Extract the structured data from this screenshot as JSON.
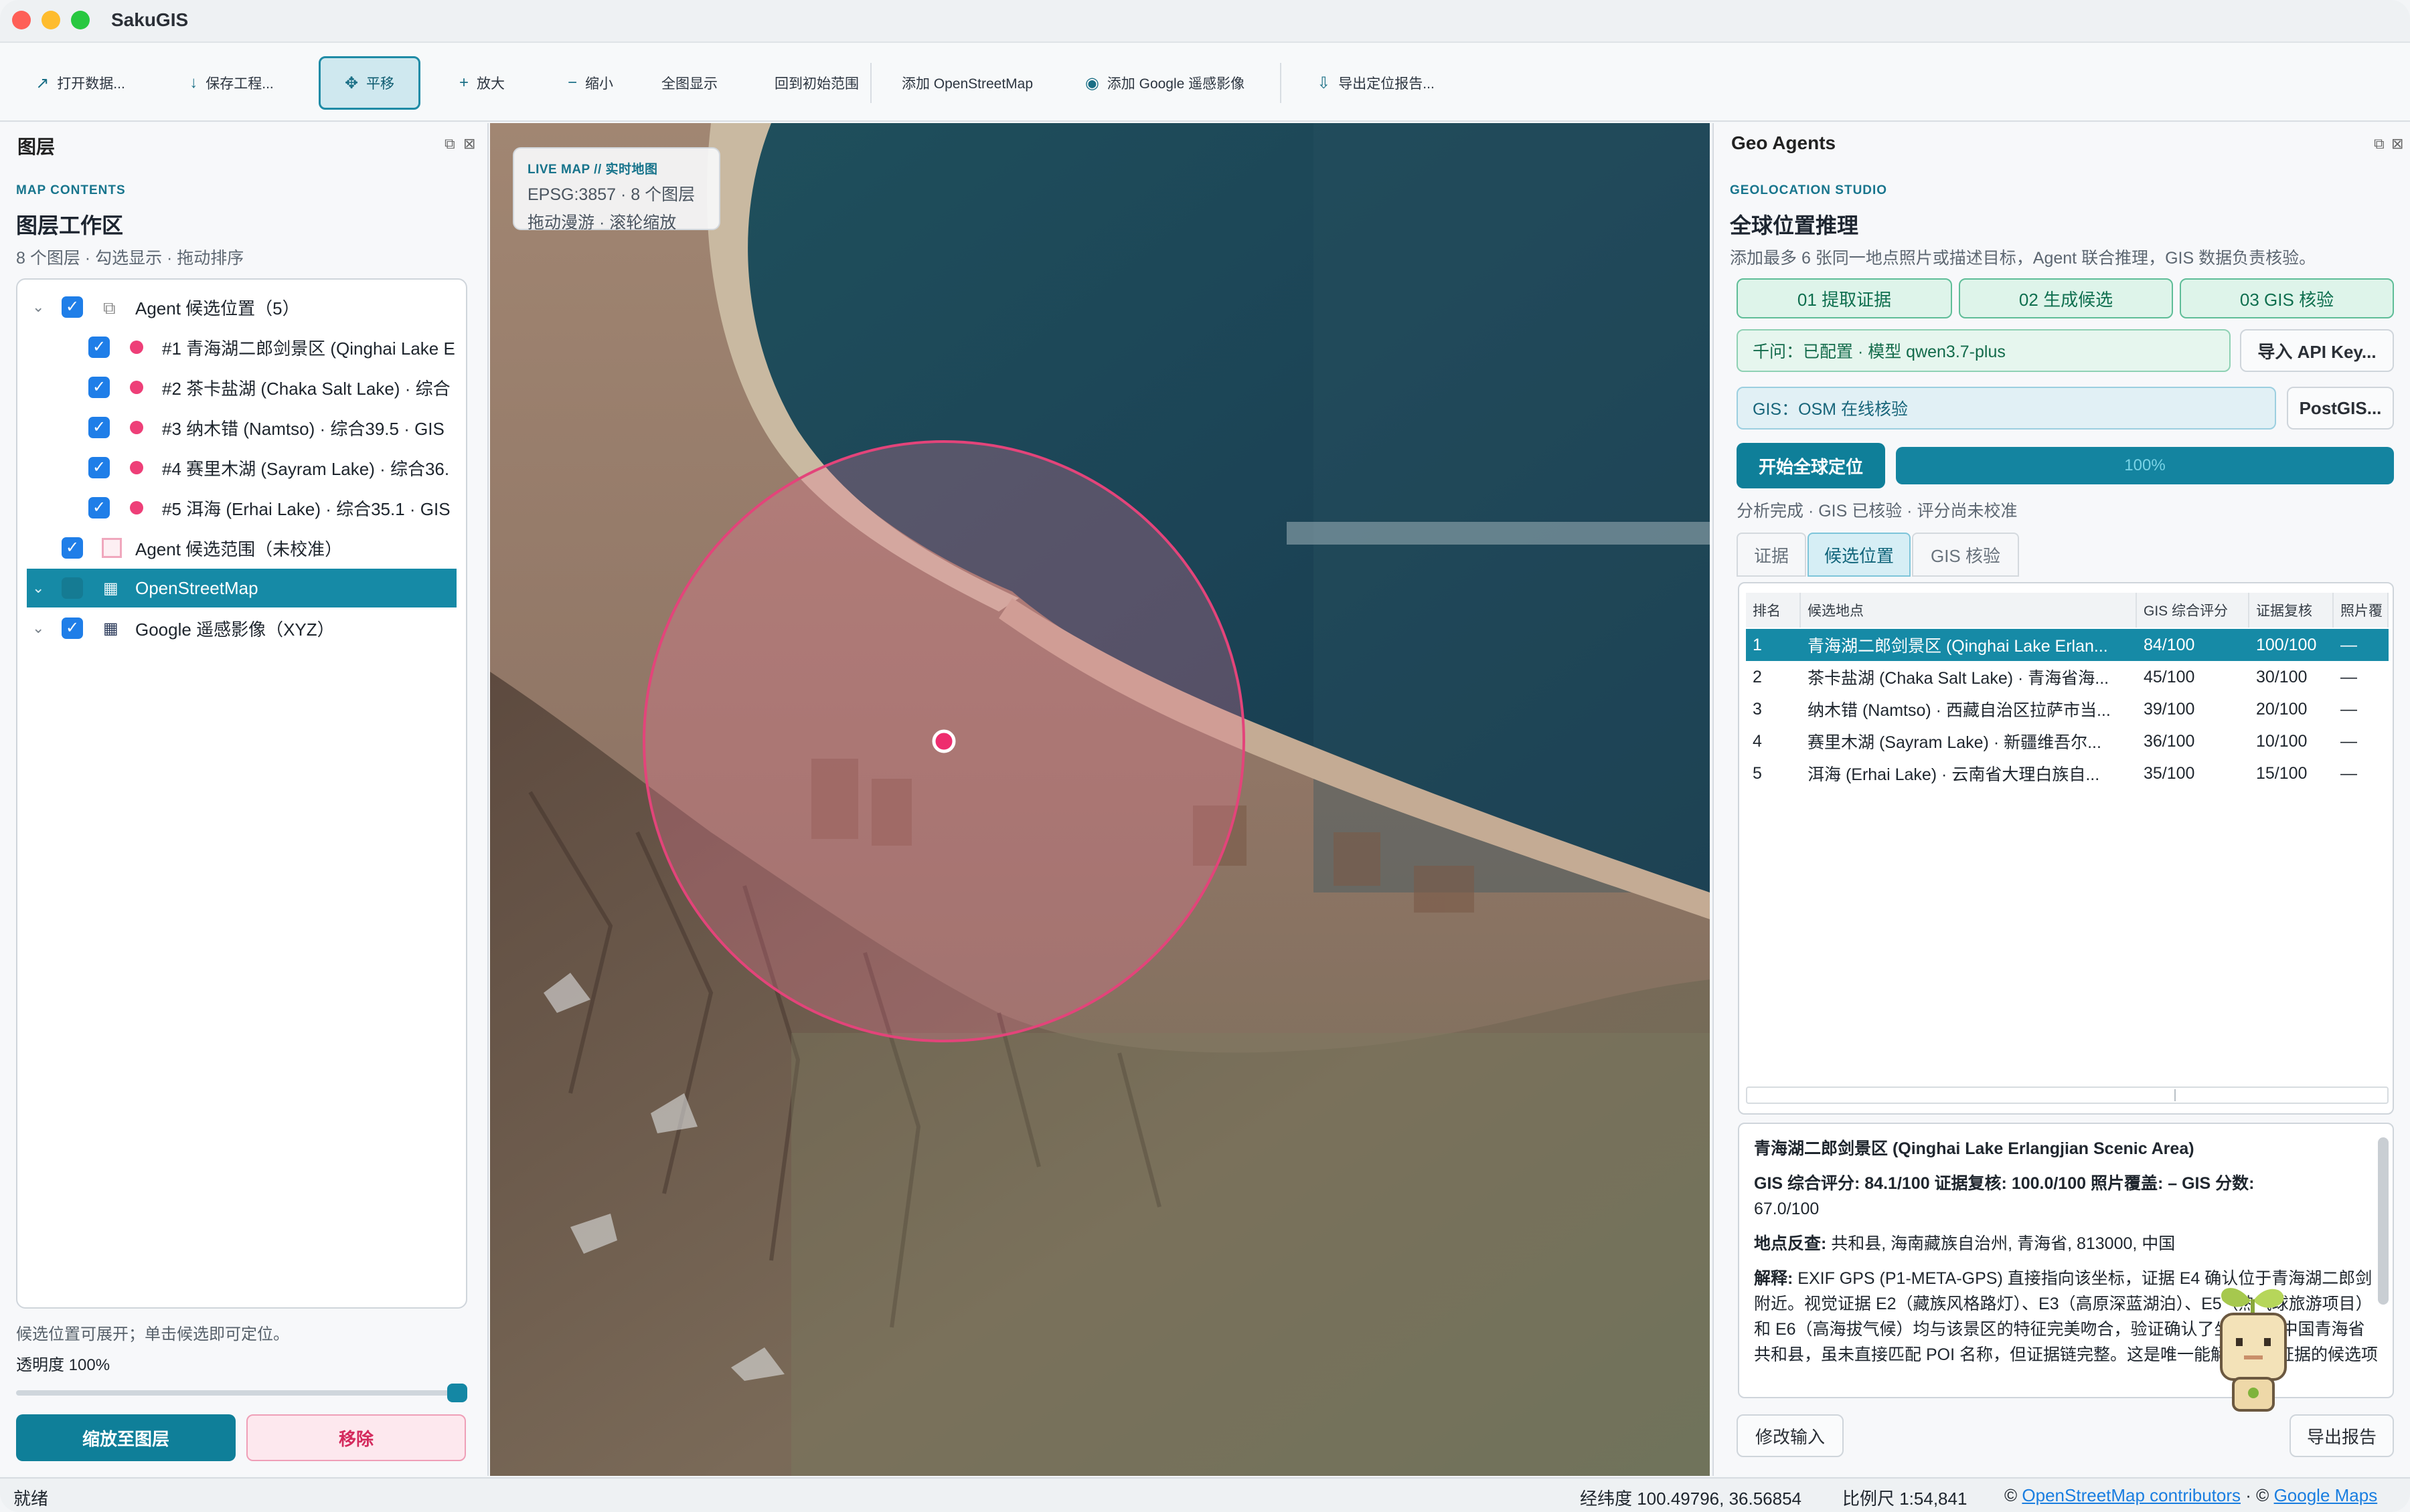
{
  "app": {
    "title": "SakuGIS"
  },
  "toolbar": {
    "open_data": "打开数据...",
    "save_project": "保存工程...",
    "pan": "平移",
    "zoom_in": "放大",
    "zoom_out": "缩小",
    "full_extent": "全图显示",
    "initial_extent": "回到初始范围",
    "add_osm": "添加 OpenStreetMap",
    "add_google": "添加 Google 遥感影像",
    "export_report": "导出定位报告..."
  },
  "layers_panel": {
    "title": "图层",
    "overline": "MAP CONTENTS",
    "heading": "图层工作区",
    "subtitle": "8 个图层 · 勾选显示 · 拖动排序",
    "tree": {
      "group_agent": "Agent 候选位置（5）",
      "candidates": [
        "#1 青海湖二郎剑景区 (Qinghai Lake E",
        "#2 茶卡盐湖 (Chaka Salt Lake) · 综合",
        "#3 纳木错 (Namtso) · 综合39.5 · GIS",
        "#4 赛里木湖 (Sayram Lake) · 综合36.",
        "#5 洱海 (Erhai Lake) · 综合35.1 · GIS"
      ],
      "range_layer": "Agent 候选范围（未校准）",
      "osm_layer": "OpenStreetMap",
      "google_layer": "Google 遥感影像（XYZ）"
    },
    "hint": "候选位置可展开；单击候选即可定位。",
    "opacity_label": "透明度 100%",
    "opacity_value": 1.0,
    "zoom_to_layer": "缩放至图层",
    "remove": "移除"
  },
  "map": {
    "live_line1": "LIVE MAP // 实时地图",
    "live_line2": "EPSG:3857 · 8 个图层",
    "live_line3": "拖动漫游 · 滚轮缩放"
  },
  "geo_panel": {
    "title": "Geo Agents",
    "overline": "GEOLOCATION STUDIO",
    "heading": "全球位置推理",
    "description": "添加最多 6 张同一地点照片或描述目标，Agent 联合推理，GIS 数据负责核验。",
    "steps": [
      "01 提取证据",
      "02 生成候选",
      "03 GIS 核验"
    ],
    "model_status": "千问：已配置 · 模型 qwen3.7-plus",
    "import_api": "导入 API Key...",
    "gis_status": "GIS：OSM 在线核验",
    "postgis": "PostGIS...",
    "start": "开始全球定位",
    "progress_text": "100%",
    "progress_value": 1.0,
    "analysis_status": "分析完成 · GIS 已核验 · 评分尚未校准",
    "tabs": [
      "证据",
      "候选位置",
      "GIS 核验"
    ],
    "table": {
      "headers": [
        "排名",
        "候选地点",
        "GIS 综合评分",
        "证据复核",
        "照片覆"
      ],
      "rows": [
        [
          "1",
          "青海湖二郎剑景区 (Qinghai Lake Erlan...",
          "84/100",
          "100/100",
          "—"
        ],
        [
          "2",
          "茶卡盐湖 (Chaka Salt Lake) · 青海省海...",
          "45/100",
          "30/100",
          "—"
        ],
        [
          "3",
          "纳木错 (Namtso) · 西藏自治区拉萨市当...",
          "39/100",
          "20/100",
          "—"
        ],
        [
          "4",
          "赛里木湖 (Sayram Lake) · 新疆维吾尔...",
          "36/100",
          "10/100",
          "—"
        ],
        [
          "5",
          "洱海 (Erhai Lake) · 云南省大理白族自...",
          "35/100",
          "15/100",
          "—"
        ]
      ]
    },
    "detail": {
      "title": "青海湖二郎剑景区 (Qinghai Lake Erlangjian Scenic Area)",
      "score_line1": "GIS 综合评分: 84.1/100  证据复核: 100.0/100  照片覆盖: –  GIS 分数:",
      "score_line2": "67.0/100",
      "geocode_label": "地点反查:",
      "geocode_value": "共和县, 海南藏族自治州, 青海省, 813000, 中国",
      "explain_label": "解释:",
      "explain_text": "EXIF GPS (P1-META-GPS) 直接指向该坐标，证据 E4 确认位于青海湖二郎剑附近。视觉证据 E2（藏族风格路灯）、E3（高原深蓝湖泊）、E5（热气球旅游项目）和 E6（高海拔气候）均与该景区的特征完美吻合，验证确认了坐标位于中国青海省共和县，虽未直接匹配 POI 名称，但证据链完整。这是唯一能解释所有证据的候选项"
    },
    "edit_input": "修改输入",
    "export_report": "导出报告"
  },
  "statusbar": {
    "ready": "就绪",
    "coords": "经纬度 100.49796, 36.56854",
    "scale": "比例尺 1:54,841",
    "attr_osm": "OpenStreetMap contributors",
    "attr_google": "Google Maps",
    "copyright": "©"
  }
}
